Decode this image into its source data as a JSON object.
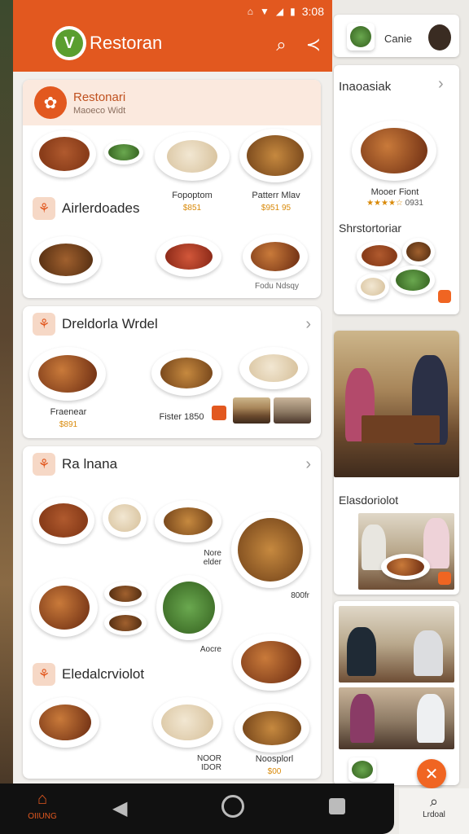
{
  "status_bar": {
    "time": "3:08"
  },
  "app_bar": {
    "title": "Restoran",
    "logo_letter": "V"
  },
  "hero": {
    "title": "Restonari",
    "subtitle": "Maoeco Widt"
  },
  "card1": {
    "title": "Airlerdoades",
    "items": [
      {
        "name": "Fopoptom",
        "price": "$851"
      },
      {
        "name": "Patterr Mlav",
        "price": "$951 95"
      },
      {
        "name": "Fodu  Ndsqy",
        "price": ""
      }
    ]
  },
  "card2": {
    "title": "Dreldorla Wrdel",
    "items": [
      {
        "name": "Fraenear",
        "price": "$891"
      },
      {
        "name": "Fister  1850",
        "price": ""
      }
    ]
  },
  "card3": {
    "title": "Ra lnana",
    "labels": [
      "Nore\nelder",
      "800fr",
      "Aocre"
    ]
  },
  "card4": {
    "title": "Eledalcrviolot",
    "items": [
      {
        "name": "NOOR\nIDOR",
        "price": ""
      },
      {
        "name": "Noosplorl",
        "price": "$00"
      }
    ]
  },
  "right": {
    "top_label": "Canie",
    "card1_title": "Inaoasiak",
    "card1_item": {
      "name": "Mooer Fiont",
      "price": "0931"
    },
    "card1_section": "Shrstortoriar",
    "card2_title": "Elasdoriolot"
  },
  "nav": {
    "home_label": "OIIUNG",
    "right_label": "Lrdoal"
  },
  "colors": {
    "brand": "#e2581f",
    "price": "#d98a0a"
  }
}
